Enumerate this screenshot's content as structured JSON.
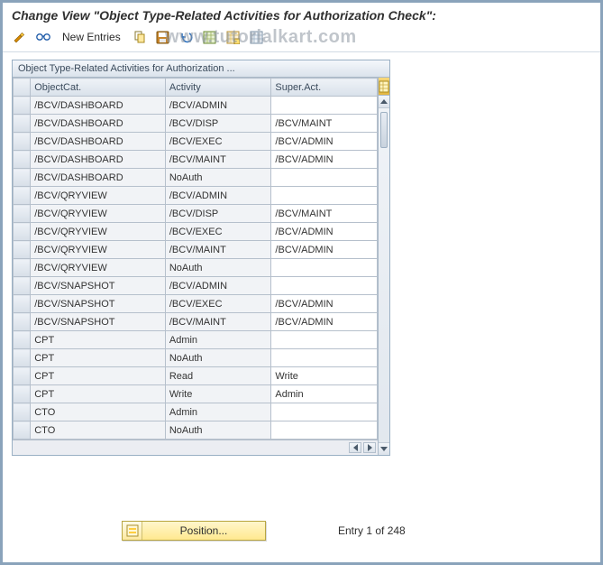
{
  "title": "Change View \"Object Type-Related Activities for Authorization Check\":",
  "watermark": "www.tutorialkart.com",
  "toolbar": {
    "newEntriesLabel": "New Entries"
  },
  "panel": {
    "title": "Object Type-Related Activities for Authorization ..."
  },
  "columns": {
    "c1": "ObjectCat.",
    "c2": "Activity",
    "c3": "Super.Act."
  },
  "rows": [
    {
      "objectCat": "/BCV/DASHBOARD",
      "activity": "/BCV/ADMIN",
      "superAct": ""
    },
    {
      "objectCat": "/BCV/DASHBOARD",
      "activity": "/BCV/DISP",
      "superAct": "/BCV/MAINT"
    },
    {
      "objectCat": "/BCV/DASHBOARD",
      "activity": "/BCV/EXEC",
      "superAct": "/BCV/ADMIN"
    },
    {
      "objectCat": "/BCV/DASHBOARD",
      "activity": "/BCV/MAINT",
      "superAct": "/BCV/ADMIN"
    },
    {
      "objectCat": "/BCV/DASHBOARD",
      "activity": "NoAuth",
      "superAct": ""
    },
    {
      "objectCat": "/BCV/QRYVIEW",
      "activity": "/BCV/ADMIN",
      "superAct": ""
    },
    {
      "objectCat": "/BCV/QRYVIEW",
      "activity": "/BCV/DISP",
      "superAct": "/BCV/MAINT"
    },
    {
      "objectCat": "/BCV/QRYVIEW",
      "activity": "/BCV/EXEC",
      "superAct": "/BCV/ADMIN"
    },
    {
      "objectCat": "/BCV/QRYVIEW",
      "activity": "/BCV/MAINT",
      "superAct": "/BCV/ADMIN"
    },
    {
      "objectCat": "/BCV/QRYVIEW",
      "activity": "NoAuth",
      "superAct": ""
    },
    {
      "objectCat": "/BCV/SNAPSHOT",
      "activity": "/BCV/ADMIN",
      "superAct": ""
    },
    {
      "objectCat": "/BCV/SNAPSHOT",
      "activity": "/BCV/EXEC",
      "superAct": "/BCV/ADMIN"
    },
    {
      "objectCat": "/BCV/SNAPSHOT",
      "activity": "/BCV/MAINT",
      "superAct": "/BCV/ADMIN"
    },
    {
      "objectCat": "CPT",
      "activity": "Admin",
      "superAct": ""
    },
    {
      "objectCat": "CPT",
      "activity": "NoAuth",
      "superAct": ""
    },
    {
      "objectCat": "CPT",
      "activity": "Read",
      "superAct": "Write"
    },
    {
      "objectCat": "CPT",
      "activity": "Write",
      "superAct": "Admin"
    },
    {
      "objectCat": "CTO",
      "activity": "Admin",
      "superAct": ""
    },
    {
      "objectCat": "CTO",
      "activity": "NoAuth",
      "superAct": ""
    }
  ],
  "footer": {
    "positionLabel": "Position...",
    "entryText": "Entry 1 of 248"
  }
}
